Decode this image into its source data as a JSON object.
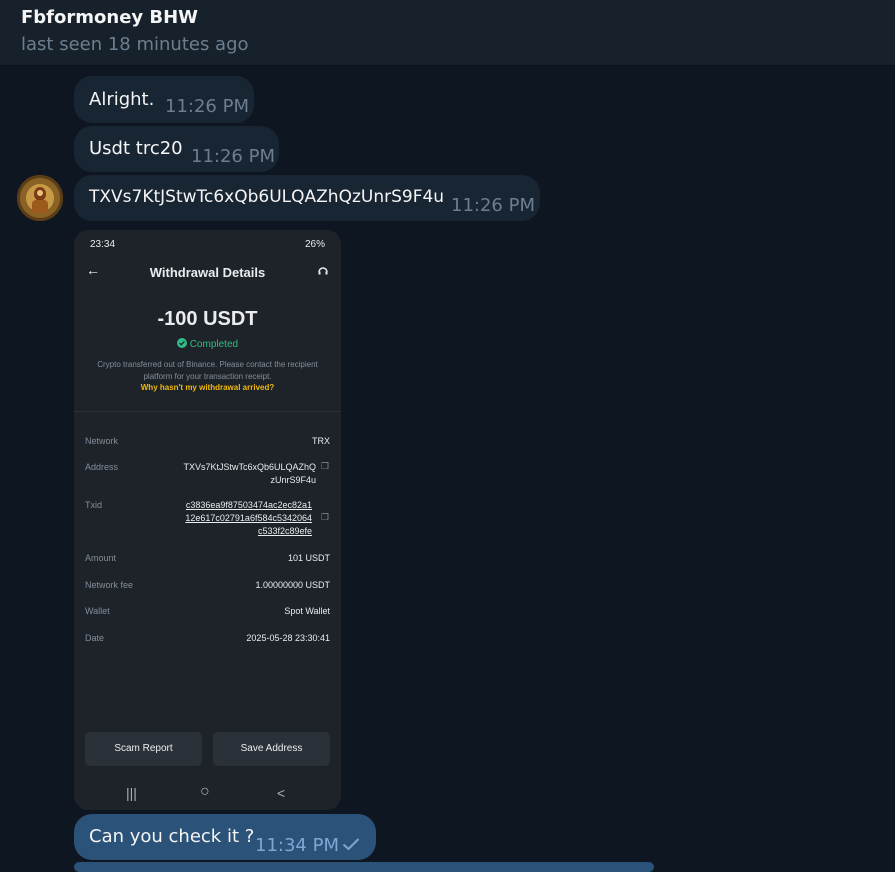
{
  "header": {
    "contact_name": "Fbformoney BHW",
    "status": "last seen 18 minutes ago"
  },
  "messages": [
    {
      "text": "Alright.",
      "time": "11:26 PM"
    },
    {
      "text": "Usdt trc20",
      "time": "11:26 PM"
    },
    {
      "text": "TXVs7KtJStwTc6xQb6ULQAZhQzUnrS9F4u",
      "time": "11:26 PM"
    }
  ],
  "screenshot": {
    "status_time": "23:34",
    "battery": "26%",
    "title": "Withdrawal Details",
    "amount": "-100 USDT",
    "status": "Completed",
    "note": "Crypto transferred out of Binance. Please contact the recipient platform for your transaction receipt.",
    "why_link": "Why hasn't my withdrawal arrived?",
    "rows": {
      "network": {
        "label": "Network",
        "value": "TRX"
      },
      "address": {
        "label": "Address",
        "line1": "TXVs7KtJStwTc6xQb6ULQAZhQ",
        "line2": "zUnrS9F4u"
      },
      "txid": {
        "label": "Txid",
        "line1": "c3836ea9f87503474ac2ec82a1",
        "line2": "12e617c02791a6f584c5342064",
        "line3": "c533f2c89efe"
      },
      "amount": {
        "label": "Amount",
        "value": "101 USDT"
      },
      "fee": {
        "label": "Network fee",
        "value": "1.00000000 USDT"
      },
      "wallet": {
        "label": "Wallet",
        "value": "Spot Wallet"
      },
      "date": {
        "label": "Date",
        "value": "2025-05-28 23:30:41"
      }
    },
    "buttons": {
      "scam_report": "Scam Report",
      "save_address": "Save Address"
    },
    "nav": {
      "recents": "|||",
      "home": "○",
      "back": "<"
    }
  },
  "outgoing": {
    "text": "Can you check it ?",
    "time": "11:34 PM"
  },
  "colors": {
    "background": "#0e1621",
    "incoming_bubble": "#182533",
    "outgoing_bubble": "#2b5278",
    "accent_green": "#2ebd85",
    "accent_yellow": "#f0b90b"
  }
}
